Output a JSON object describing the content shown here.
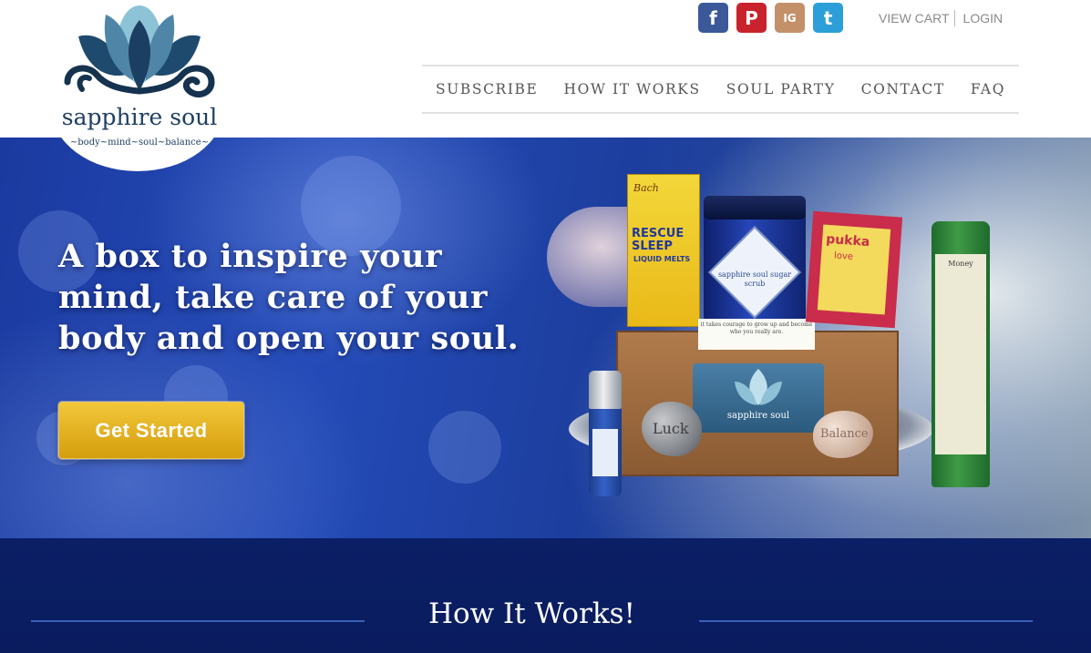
{
  "logo": {
    "name": "sapphire soul",
    "tagline": "~body~mind~soul~balance~"
  },
  "social": {
    "facebook": "f",
    "pinterest": "P",
    "instagram": "IG",
    "twitter": "t"
  },
  "account": {
    "view_cart": "VIEW CART",
    "login": "LOGIN"
  },
  "nav": {
    "items": [
      "SUBSCRIBE",
      "HOW IT WORKS",
      "SOUL PARTY",
      "CONTACT",
      "FAQ"
    ]
  },
  "hero": {
    "headline": "A box to inspire your mind, take care of your body and open your soul.",
    "cta_label": "Get Started",
    "products": {
      "rescue_brand": "Bach",
      "rescue_name": "RESCUE SLEEP",
      "rescue_sub": "LIQUID MELTS",
      "jar_label": "sapphire soul sugar scrub",
      "note_text": "it takes courage to grow up and become who you really are.",
      "pukka_brand": "pukka",
      "pukka_name": "love",
      "candle_label": "Money",
      "card_text": "sapphire soul",
      "stone_luck": "Luck",
      "stone_balance": "Balance"
    }
  },
  "how_it_works": {
    "title": "How It Works!"
  },
  "colors": {
    "nav_text": "#555555",
    "cta": "#e6b21e",
    "hero_blue": "#244bb8",
    "section_navy": "#0b1f66",
    "logo_navy": "#1f3f63",
    "logo_teal": "#7fb9d0"
  }
}
